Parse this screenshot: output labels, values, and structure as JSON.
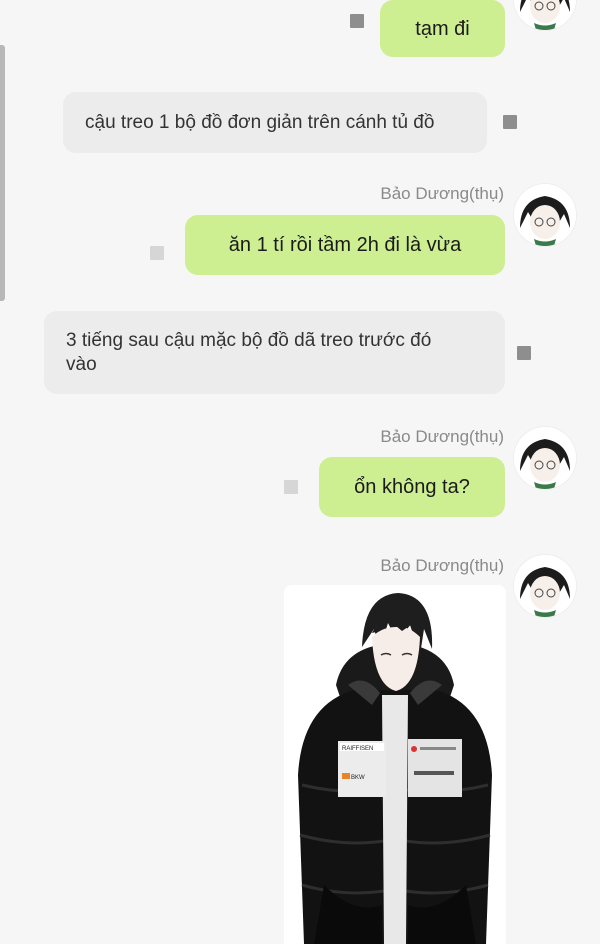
{
  "messages": [
    {
      "text": "tạm đi",
      "direction": "out"
    },
    {
      "text": "cậu treo 1 bộ đồ đơn giản trên cánh tủ đồ",
      "direction": "in"
    },
    {
      "text": "ăn 1 tí rồi tầm 2h đi là vừa",
      "direction": "out",
      "sender": "Bảo Dương(thụ)"
    },
    {
      "text": "3 tiếng sau cậu mặc bộ đồ dã treo trước đó vào",
      "direction": "in"
    },
    {
      "text": "ổn không ta?",
      "direction": "out",
      "sender": "Bảo Dương(thụ)"
    },
    {
      "direction": "out",
      "sender": "Bảo Dương(thụ)",
      "attachment": "photo"
    }
  ],
  "jacket_patches": [
    "RAIFFISEN",
    "BKW"
  ],
  "colors": {
    "background": "#f6f6f6",
    "outgoing_bubble": "#cdee91",
    "incoming_bubble": "#ececec",
    "sender_name": "#8a8a8a"
  },
  "icons": [
    "message-status-icon",
    "avatar"
  ]
}
